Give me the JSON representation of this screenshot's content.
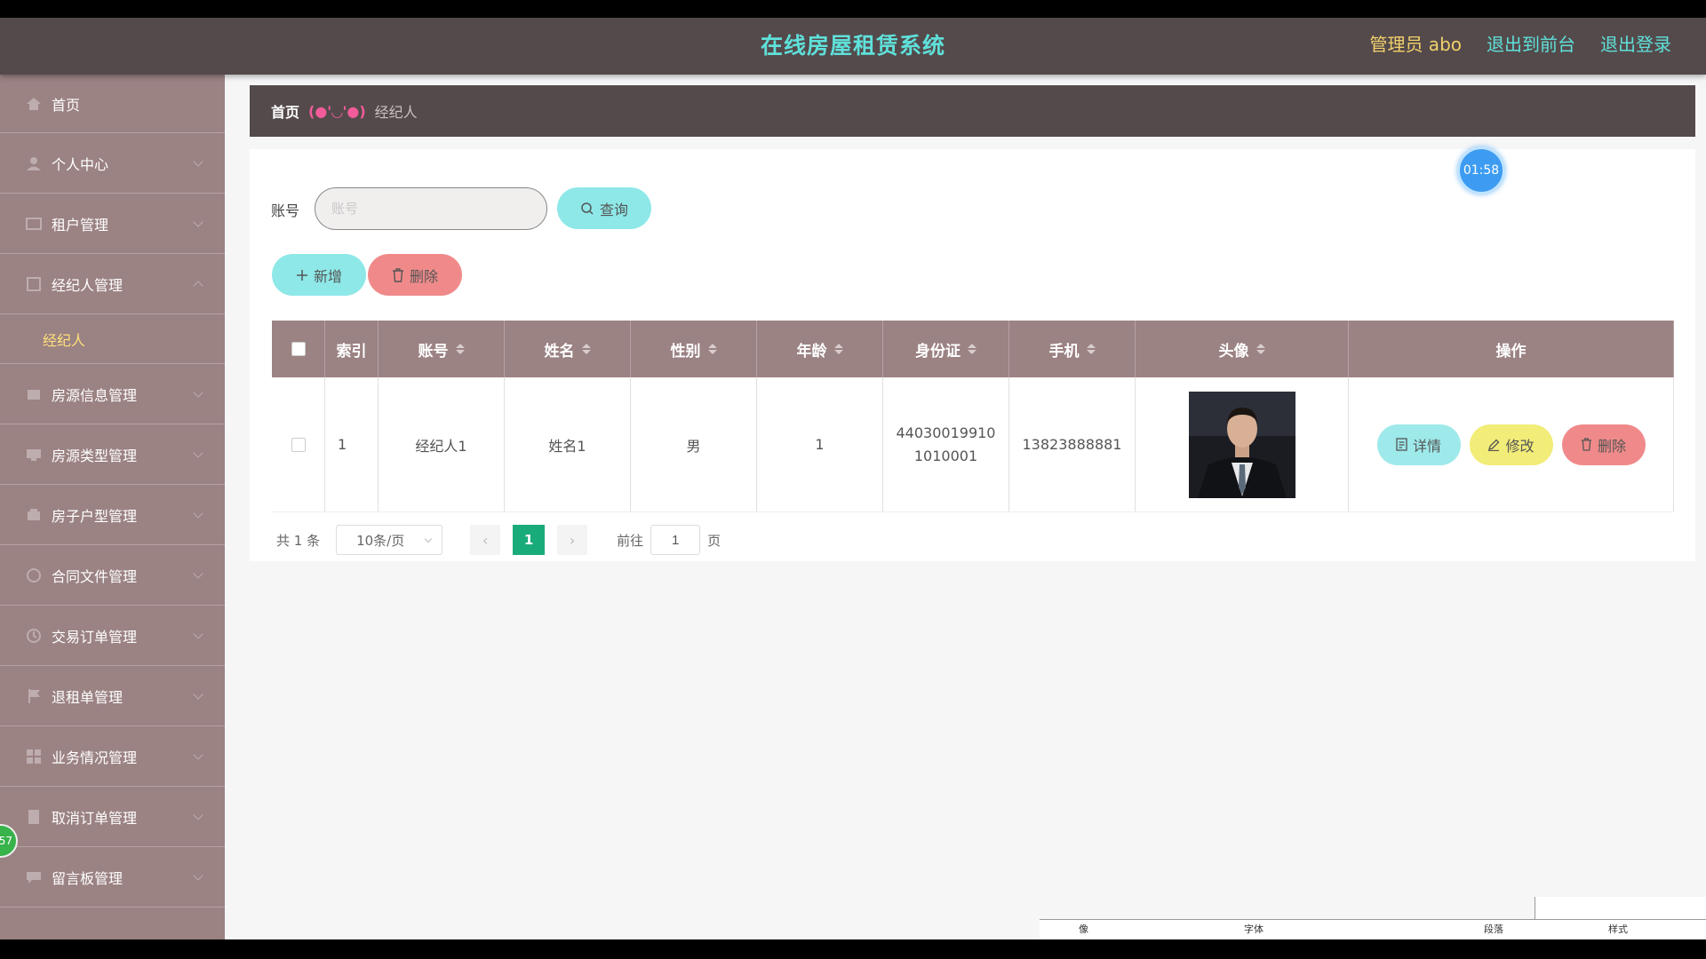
{
  "header": {
    "app_title": "在线房屋租赁系统",
    "admin_label": "管理员 abo",
    "back_to_front": "退出到前台",
    "logout": "退出登录"
  },
  "sidebar": {
    "items": [
      {
        "label": "首页",
        "icon": "home-icon"
      },
      {
        "label": "个人中心",
        "icon": "user-icon"
      },
      {
        "label": "租户管理",
        "icon": "tenant-icon"
      },
      {
        "label": "经纪人管理",
        "icon": "agent-icon",
        "expanded": true,
        "sub": "经纪人"
      },
      {
        "label": "房源信息管理",
        "icon": "house-icon"
      },
      {
        "label": "房源类型管理",
        "icon": "type-icon"
      },
      {
        "label": "房子户型管理",
        "icon": "layout-icon"
      },
      {
        "label": "合同文件管理",
        "icon": "contract-icon"
      },
      {
        "label": "交易订单管理",
        "icon": "order-icon"
      },
      {
        "label": "退租单管理",
        "icon": "flag-icon"
      },
      {
        "label": "业务情况管理",
        "icon": "grid-icon"
      },
      {
        "label": "取消订单管理",
        "icon": "cancel-icon"
      },
      {
        "label": "留言板管理",
        "icon": "message-icon"
      }
    ],
    "floating_badge": "57"
  },
  "breadcrumb": {
    "home": "首页",
    "separator": "(●'◡'●)",
    "current": "经纪人"
  },
  "search": {
    "label": "账号",
    "placeholder": "账号",
    "value": "",
    "query_button": "查询"
  },
  "actions": {
    "add_button": "新增",
    "delete_button": "删除"
  },
  "timer": "01:58",
  "table": {
    "columns": [
      "索引",
      "账号",
      "姓名",
      "性别",
      "年龄",
      "身份证",
      "手机",
      "头像",
      "操作"
    ],
    "rows": [
      {
        "index": "1",
        "account": "经纪人1",
        "name": "姓名1",
        "gender": "男",
        "age": "1",
        "id_card_line1": "44030019910",
        "id_card_line2": "1010001",
        "phone": "13823888881",
        "ops": {
          "detail": "详情",
          "edit": "修改",
          "delete": "删除"
        }
      }
    ]
  },
  "pagination": {
    "total": "共 1 条",
    "page_size": "10条/页",
    "current_page": "1",
    "goto_label": "前往",
    "goto_value": "1",
    "page_unit": "页"
  },
  "colors": {
    "topbar": "#544a4b",
    "sidebar": "#9b8283",
    "title_accent": "#5fe0da",
    "admin_accent": "#f2d16b",
    "query_btn": "#8ee8e8",
    "delete_btn": "#f08a8a",
    "edit_btn": "#f2ec78",
    "page_active": "#1aab7a"
  },
  "bottom_fragment": [
    "像",
    "字体",
    "段落",
    "样式"
  ]
}
